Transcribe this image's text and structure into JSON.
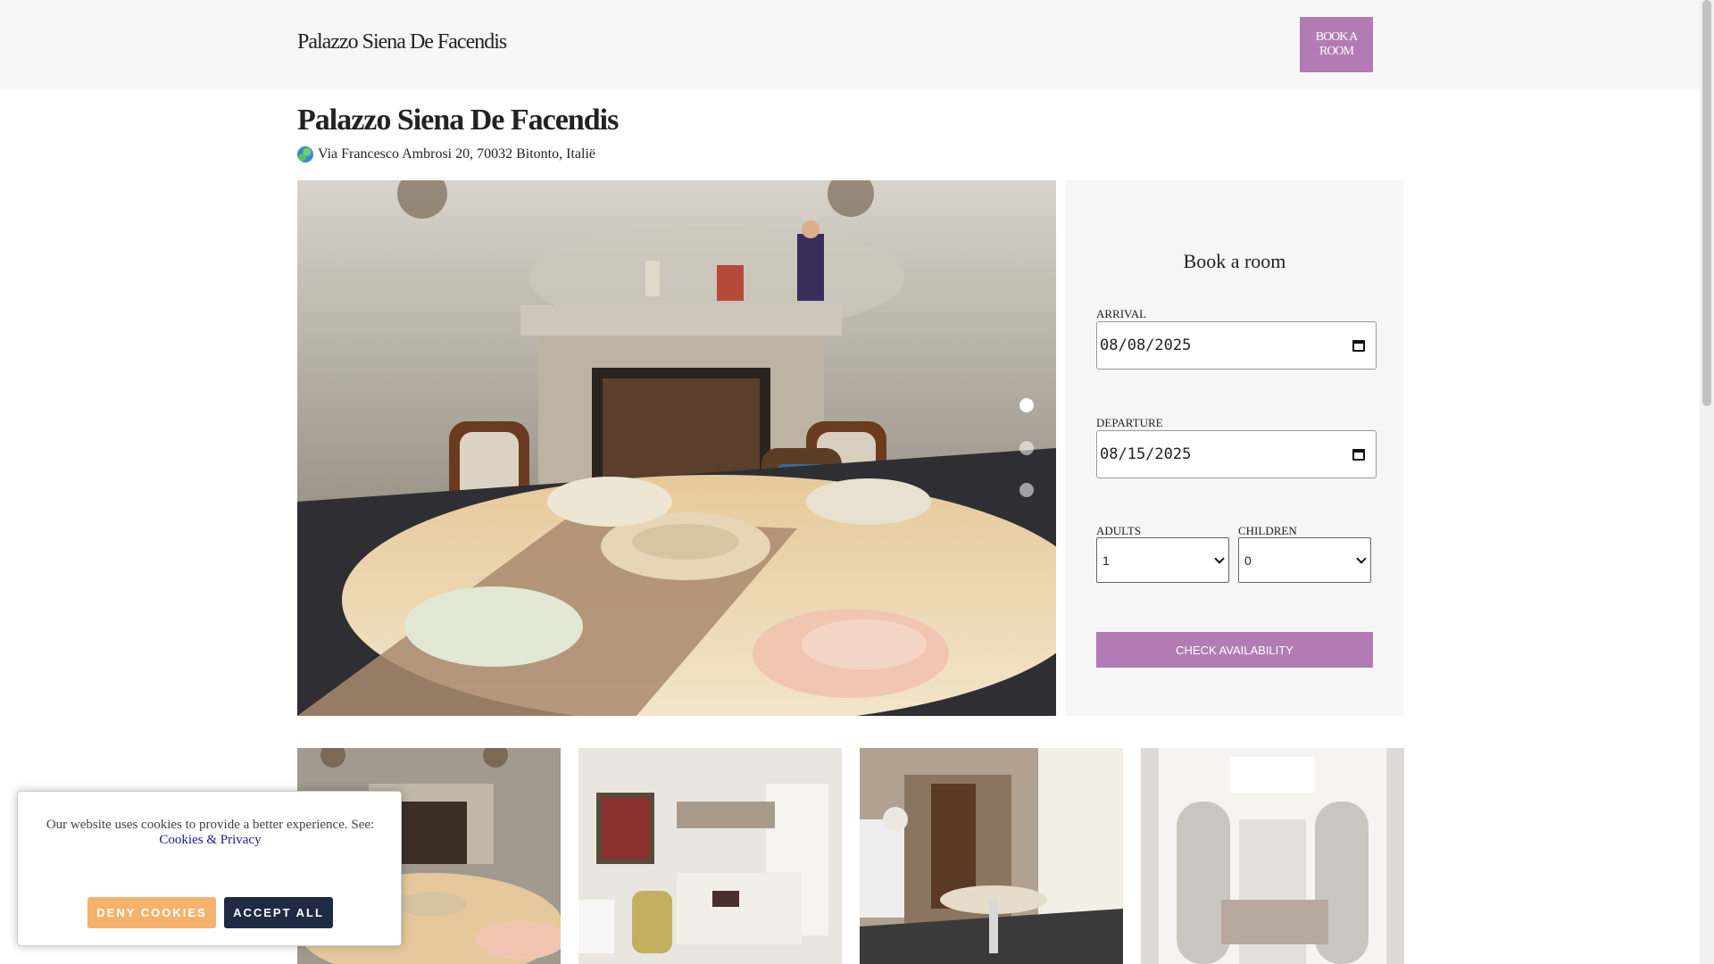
{
  "header": {
    "brand": "Palazzo Siena De Facendis",
    "book_button": "BOOK A ROOM",
    "background": "#f7f7f7",
    "accent": "#b37bb3"
  },
  "property": {
    "title": "Palazzo Siena De Facendis",
    "address_icon": "globe-icon",
    "address": "Via Francesco Ambrosi 20, 70032 Bitonto, Italië"
  },
  "gallery": {
    "slides_total": 3,
    "active_slide": 1,
    "thumbnails": [
      "dining-fireplace",
      "canopy-bedroom",
      "stone-arch-dining",
      "white-wardrobe-bedroom"
    ]
  },
  "booking": {
    "heading": "Book a room",
    "arrival_label": "ARRIVAL",
    "arrival_value": "08/08/2025",
    "departure_label": "DEPARTURE",
    "departure_value": "08/15/2025",
    "adults_label": "ADULTS",
    "adults_value": "1",
    "children_label": "CHILDREN",
    "children_value": "0",
    "check_button": "CHECK AVAILABILITY"
  },
  "cookie": {
    "message": "Our website uses cookies to provide a better experience. See:",
    "link": "Cookies & Privacy",
    "deny": "DENY COOKIES",
    "accept": "ACCEPT ALL",
    "deny_color": "#f6b26b",
    "accept_color": "#1f2a44"
  }
}
